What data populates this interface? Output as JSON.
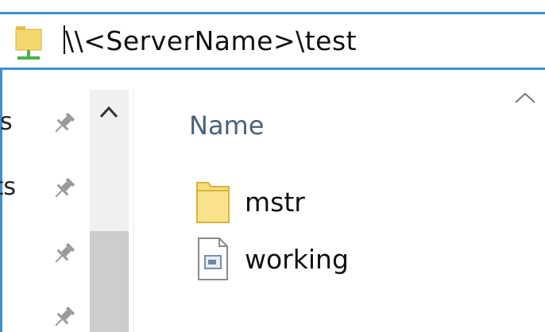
{
  "address_bar": {
    "path": "\\\\<ServerName>\\test",
    "icon": "network-folder-icon"
  },
  "nav_pane": {
    "items": [
      {
        "label_fragment": "s",
        "pin_icon": "pin-icon"
      },
      {
        "label_fragment": "ts",
        "pin_icon": "pin-icon"
      },
      {
        "label_fragment": "",
        "pin_icon": "pin-icon"
      },
      {
        "label_fragment": "",
        "pin_icon": "pin-icon"
      }
    ]
  },
  "file_list": {
    "column_header": "Name",
    "items": [
      {
        "name": "mstr",
        "type": "folder",
        "icon": "folder-icon"
      },
      {
        "name": "working",
        "type": "file",
        "icon": "document-icon"
      }
    ]
  },
  "colors": {
    "accent": "#3c8fd5",
    "folder": "#f5d76e",
    "header_text": "#4c607a"
  }
}
